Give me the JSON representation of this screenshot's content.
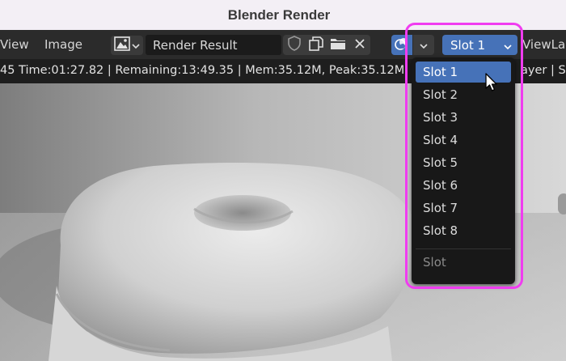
{
  "window": {
    "title": "Blender Render"
  },
  "menus": {
    "view": "View",
    "image": "Image"
  },
  "image_name": "Render Result",
  "slot_selector": {
    "value": "Slot 1"
  },
  "viewlayer_label": "ViewLa",
  "info_text": "45 Time:01:27.82 | Remaining:13:49.35 | Mem:35.12M, Peak:35.12M",
  "info_text_right": "ayer | Sa",
  "dropdown": {
    "items": [
      "Slot 1",
      "Slot 2",
      "Slot 3",
      "Slot 4",
      "Slot 5",
      "Slot 6",
      "Slot 7",
      "Slot 8"
    ],
    "selected_index": 0,
    "footer_label": "Slot"
  },
  "colors": {
    "accent": "#4672b8",
    "highlight": "#f03cf0",
    "title_bar": "#f3eff5",
    "header": "#2b2b2b",
    "menu_bg": "#181818"
  },
  "icons": {
    "image_type": "image-icon",
    "fake_user": "shield-icon",
    "duplicate": "duplicate-icon",
    "open": "folder-icon",
    "unlink": "close-icon",
    "display_channels": "color-channels-icon",
    "cursor": "mouse-pointer-icon"
  }
}
